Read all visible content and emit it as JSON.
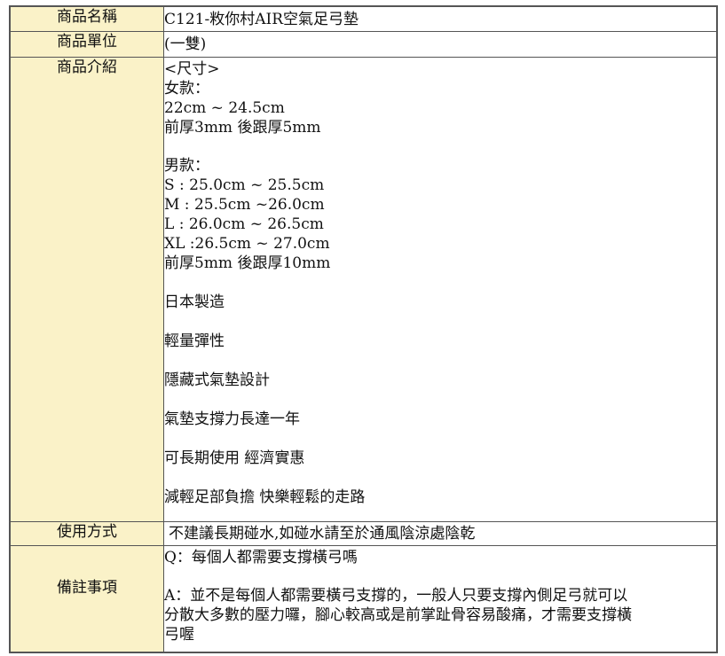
{
  "rows": {
    "name": {
      "label": "商品名稱",
      "value": "C121-敉你村AIR空氣足弓墊"
    },
    "unit": {
      "label": "商品單位",
      "value": "(一雙)"
    },
    "intro": {
      "label": "商品介紹",
      "size_header": "<尺寸>",
      "women_title": "女款：",
      "women_range": "22cm ~ 24.5cm",
      "women_thickness": "前厚3mm 後跟厚5mm",
      "men_title": "男款：",
      "men_s": "S : 25.0cm ~ 25.5cm",
      "men_m": "M : 25.5cm ~26.0cm",
      "men_l": "L : 26.0cm ~ 26.5cm",
      "men_xl": "XL :26.5cm ~ 27.0cm",
      "men_thickness": "前厚5mm 後跟厚10mm",
      "feature_1": "日本製造",
      "feature_2": "輕量彈性",
      "feature_3": "隱藏式氣墊設計",
      "feature_4": "氣墊支撐力長達一年",
      "feature_5": "可長期使用 經濟實惠",
      "feature_6": "減輕足部負擔 快樂輕鬆的走路"
    },
    "usage": {
      "label": "使用方式",
      "value": "不建議長期碰水,如碰水請至於通風陰涼處陰乾"
    },
    "notes": {
      "label": "備註事項",
      "question": "Q：每個人都需要支撐橫弓嗎",
      "answer_1": "A：並不是每個人都需要橫弓支撐的，一般人只要支撐內側足弓就可以",
      "answer_2": "分散大多數的壓力囉，腳心較高或是前掌趾骨容易酸痛，才需要支撐橫",
      "answer_3": "弓喔"
    }
  },
  "colors": {
    "label_bg": "#faf2c8",
    "border": "#555555"
  }
}
